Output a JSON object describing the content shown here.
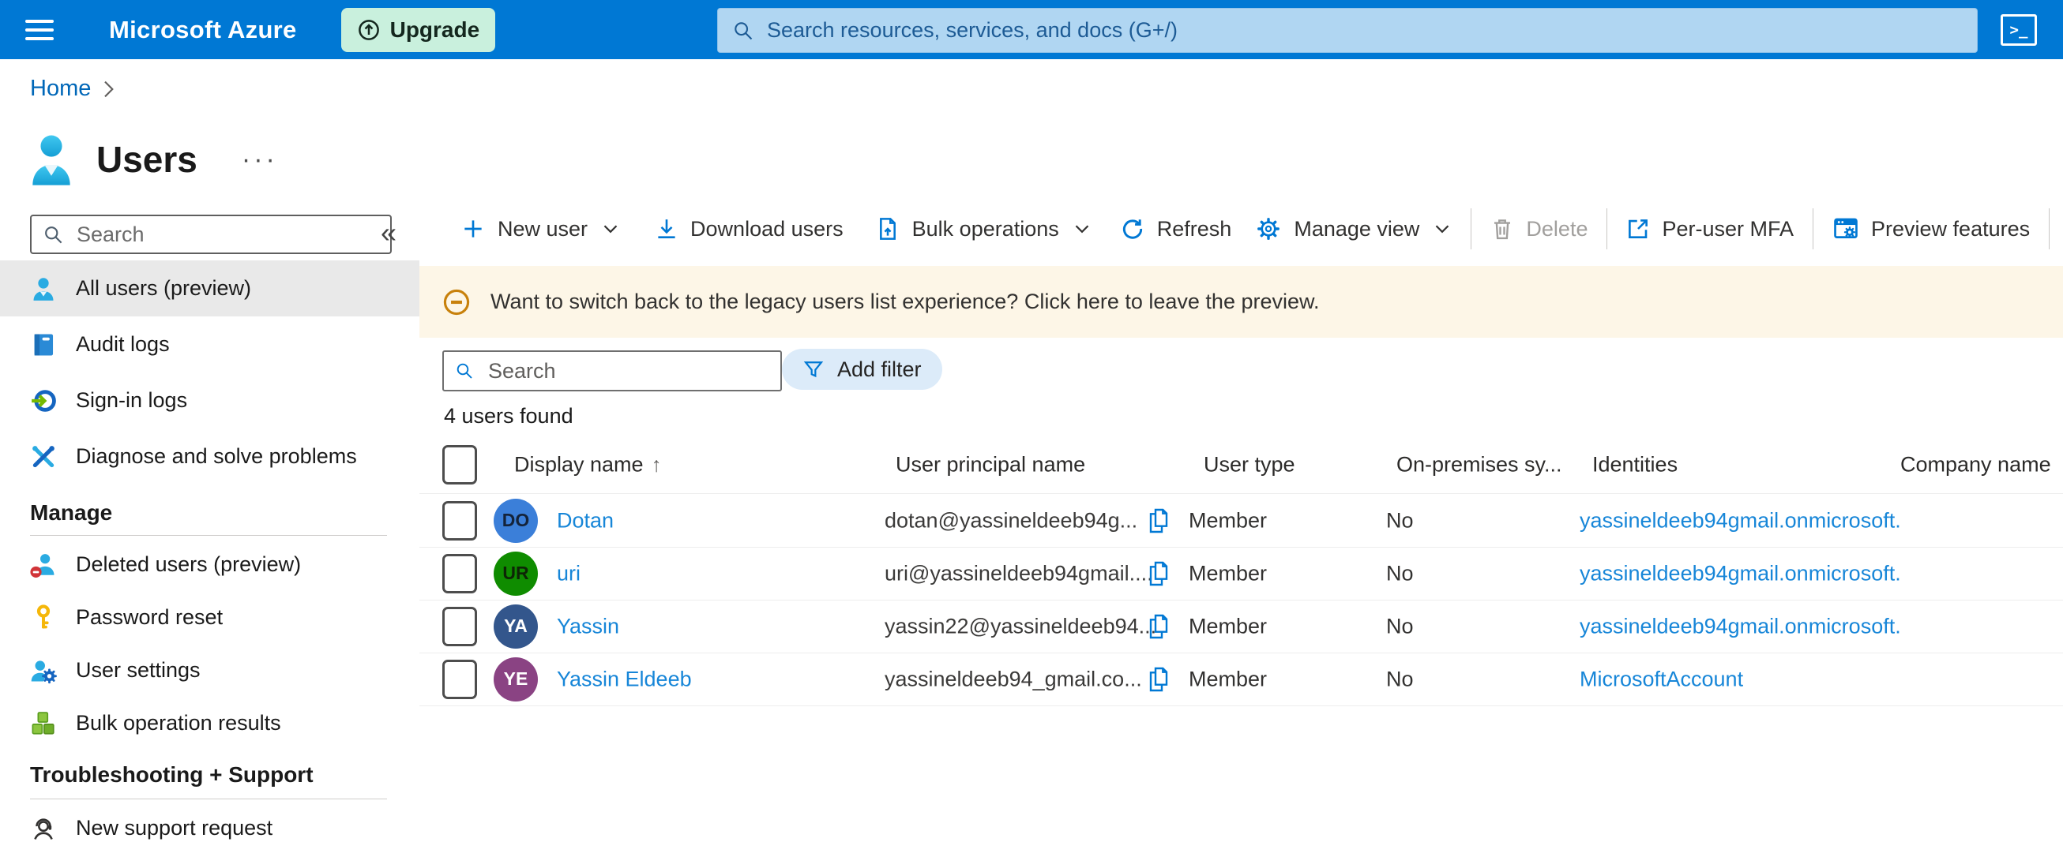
{
  "topbar": {
    "brand": "Microsoft Azure",
    "upgrade_label": "Upgrade",
    "search_placeholder": "Search resources, services, and docs (G+/)",
    "cloudshell_glyph": ">_",
    "colors": {
      "bar": "#0078d4",
      "search_bg": "#b0d6f2",
      "upgrade_bg": "#c9f0dd"
    }
  },
  "breadcrumb": {
    "home": "Home"
  },
  "page": {
    "title": "Users",
    "overflow_label": "···"
  },
  "sidebar": {
    "search_placeholder": "Search",
    "collapse_glyph": "«",
    "items": [
      {
        "label": "All users (preview)",
        "icon": "user-icon",
        "selected": true
      },
      {
        "label": "Audit logs",
        "icon": "book-icon"
      },
      {
        "label": "Sign-in logs",
        "icon": "sign-in-icon"
      },
      {
        "label": "Diagnose and solve problems",
        "icon": "tools-icon"
      }
    ],
    "sections": [
      {
        "header": "Manage",
        "items": [
          {
            "label": "Deleted users (preview)",
            "icon": "deleted-user-icon"
          },
          {
            "label": "Password reset",
            "icon": "key-icon"
          },
          {
            "label": "User settings",
            "icon": "user-gear-icon"
          },
          {
            "label": "Bulk operation results",
            "icon": "cubes-icon"
          }
        ]
      },
      {
        "header": "Troubleshooting + Support",
        "items": [
          {
            "label": "New support request",
            "icon": "headset-icon"
          }
        ]
      }
    ]
  },
  "toolbar": {
    "new_user": "New user",
    "download_users": "Download users",
    "bulk_operations": "Bulk operations",
    "refresh": "Refresh",
    "manage_view": "Manage view",
    "delete": "Delete",
    "per_user_mfa": "Per-user MFA",
    "preview_features": "Preview features"
  },
  "banner": {
    "message": "Want to switch back to the legacy users list experience? Click here to leave the preview."
  },
  "filter_bar": {
    "search_placeholder": "Search",
    "add_filter": "Add filter"
  },
  "results_count": "4 users found",
  "table": {
    "headers": {
      "display_name": "Display name",
      "sort_indicator": "↑",
      "user_principal_name": "User principal name",
      "user_type": "User type",
      "on_premises": "On-premises sy...",
      "identities": "Identities",
      "company_name": "Company name"
    },
    "rows": [
      {
        "initials": "DO",
        "avatar_color": "#3b7fd9",
        "initials_color": "#14233a",
        "display_name": "Dotan",
        "upn": "dotan@yassineldeeb94g...",
        "user_type": "Member",
        "on_premises": "No",
        "identity": "yassineldeeb94gmail.onmicrosoft."
      },
      {
        "initials": "UR",
        "avatar_color": "#0f8c00",
        "initials_color": "#0d2506",
        "display_name": "uri",
        "upn": "uri@yassineldeeb94gmail....",
        "user_type": "Member",
        "on_premises": "No",
        "identity": "yassineldeeb94gmail.onmicrosoft."
      },
      {
        "initials": "YA",
        "avatar_color": "#33568c",
        "initials_color": "#ffffff",
        "display_name": "Yassin",
        "upn": "yassin22@yassineldeeb94...",
        "user_type": "Member",
        "on_premises": "No",
        "identity": "yassineldeeb94gmail.onmicrosoft."
      },
      {
        "initials": "YE",
        "avatar_color": "#8a4383",
        "initials_color": "#ffffff",
        "display_name": "Yassin Eldeeb",
        "upn": "yassineldeeb94_gmail.co...",
        "user_type": "Member",
        "on_premises": "No",
        "identity": "MicrosoftAccount"
      }
    ]
  }
}
